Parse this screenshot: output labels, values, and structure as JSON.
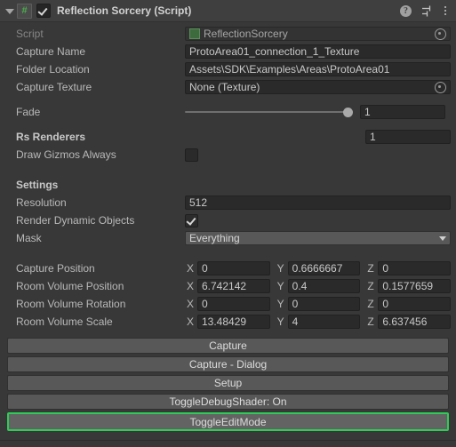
{
  "header": {
    "title": "Reflection Sorcery (Script)",
    "script_icon_glyph": "#",
    "enabled": true,
    "help_icon": "help-icon",
    "preset_icon": "preset-icon",
    "menu_icon": "kebab-menu-icon"
  },
  "fields": {
    "script": {
      "label": "Script",
      "value": "ReflectionSorcery"
    },
    "capture_name": {
      "label": "Capture Name",
      "value": "ProtoArea01_connection_1_Texture"
    },
    "folder_location": {
      "label": "Folder Location",
      "value": "Assets\\SDK\\Examples\\Areas\\ProtoArea01"
    },
    "capture_texture": {
      "label": "Capture Texture",
      "value": "None (Texture)"
    },
    "fade": {
      "label": "Fade",
      "value": "1",
      "slider_pct": 100
    },
    "rs_renderers": {
      "label": "Rs Renderers",
      "count": "1"
    },
    "draw_gizmos_always": {
      "label": "Draw Gizmos Always",
      "checked": false
    }
  },
  "settings": {
    "heading": "Settings",
    "resolution": {
      "label": "Resolution",
      "value": "512"
    },
    "render_dynamic_objects": {
      "label": "Render Dynamic Objects",
      "checked": true
    },
    "mask": {
      "label": "Mask",
      "value": "Everything"
    }
  },
  "transforms": [
    {
      "label": "Capture Position",
      "x": "0",
      "y": "0.6666667",
      "z": "0"
    },
    {
      "label": "Room Volume Position",
      "x": "6.742142",
      "y": "0.4",
      "z": "0.1577659"
    },
    {
      "label": "Room Volume Rotation",
      "x": "0",
      "y": "0",
      "z": "0"
    },
    {
      "label": "Room Volume Scale",
      "x": "13.48429",
      "y": "4",
      "z": "6.637456"
    }
  ],
  "axis_labels": {
    "x": "X",
    "y": "Y",
    "z": "Z"
  },
  "buttons": [
    {
      "label": "Capture",
      "selected": false
    },
    {
      "label": "Capture - Dialog",
      "selected": false
    },
    {
      "label": "Setup",
      "selected": false
    },
    {
      "label": "ToggleDebugShader: On",
      "selected": false
    },
    {
      "label": "ToggleEditMode",
      "selected": true
    }
  ],
  "colors": {
    "background": "#383838",
    "header_bg": "#3f3f3f",
    "field_bg": "#2a2a2a",
    "button_bg": "#585858",
    "selection_outline": "#2ecc56",
    "script_icon_green": "#4caf50"
  }
}
